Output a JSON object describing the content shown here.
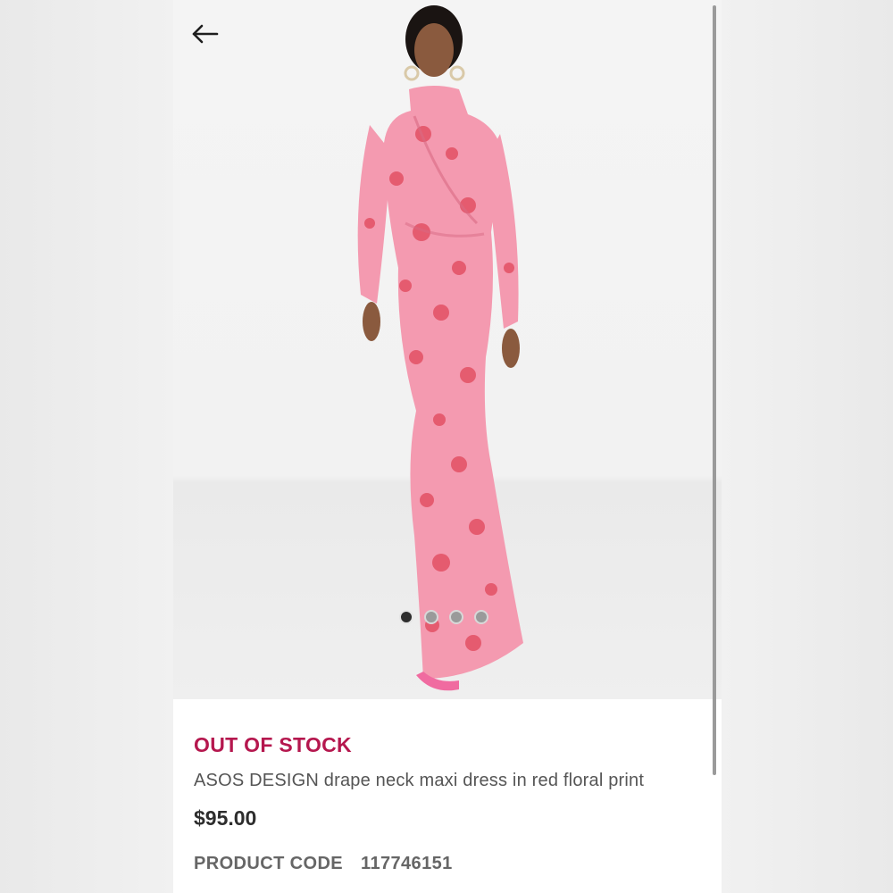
{
  "navigation": {
    "back_icon": "arrow-left-icon"
  },
  "gallery": {
    "image_subject": "model wearing pink floral drape neck maxi dress",
    "dress_color": "#f49ab0",
    "print_color": "#e0475a",
    "page_count": 4,
    "active_page": 1
  },
  "product": {
    "stock_status": "OUT OF STOCK",
    "stock_color": "#b5174e",
    "title": "ASOS DESIGN drape neck maxi dress in red floral print",
    "price": "$95.00",
    "code_label": "PRODUCT CODE",
    "code_value": "117746151"
  }
}
